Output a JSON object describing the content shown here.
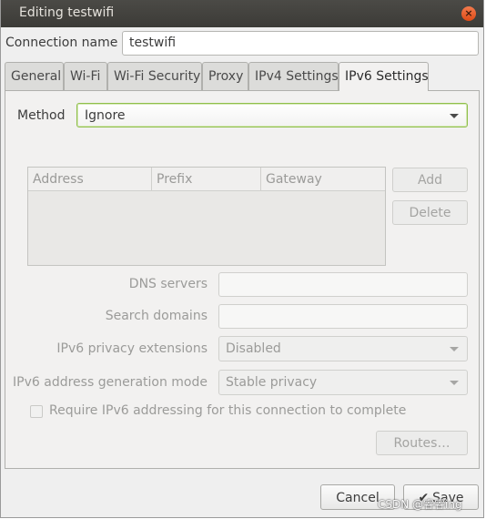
{
  "window": {
    "title": "Editing testwifi",
    "close_glyph": "×"
  },
  "connection": {
    "label": "Connection name",
    "value": "testwifi"
  },
  "tabs": [
    {
      "label": "General"
    },
    {
      "label": "Wi-Fi"
    },
    {
      "label": "Wi-Fi Security"
    },
    {
      "label": "Proxy"
    },
    {
      "label": "IPv4 Settings"
    },
    {
      "label": "IPv6 Settings",
      "active": true
    }
  ],
  "method": {
    "label": "Method",
    "value": "Ignore"
  },
  "addresses": {
    "columns": [
      "Address",
      "Prefix",
      "Gateway"
    ],
    "rows": [],
    "add_label": "Add",
    "delete_label": "Delete"
  },
  "dns": {
    "label": "DNS servers",
    "value": ""
  },
  "search_domains": {
    "label": "Search domains",
    "value": ""
  },
  "privacy": {
    "label": "IPv6 privacy extensions",
    "value": "Disabled"
  },
  "addr_gen": {
    "label": "IPv6 address generation mode",
    "value": "Stable privacy"
  },
  "require": {
    "label": "Require IPv6 addressing for this connection to complete",
    "checked": false
  },
  "routes_label": "Routes…",
  "buttons": {
    "cancel": "Cancel",
    "save": "Save",
    "save_icon": "✔"
  },
  "watermark": "CSDN @睿睿ing",
  "colors": {
    "titlebar": "#3c3b37",
    "close": "#df4b16",
    "focus": "#8fbf4a"
  }
}
